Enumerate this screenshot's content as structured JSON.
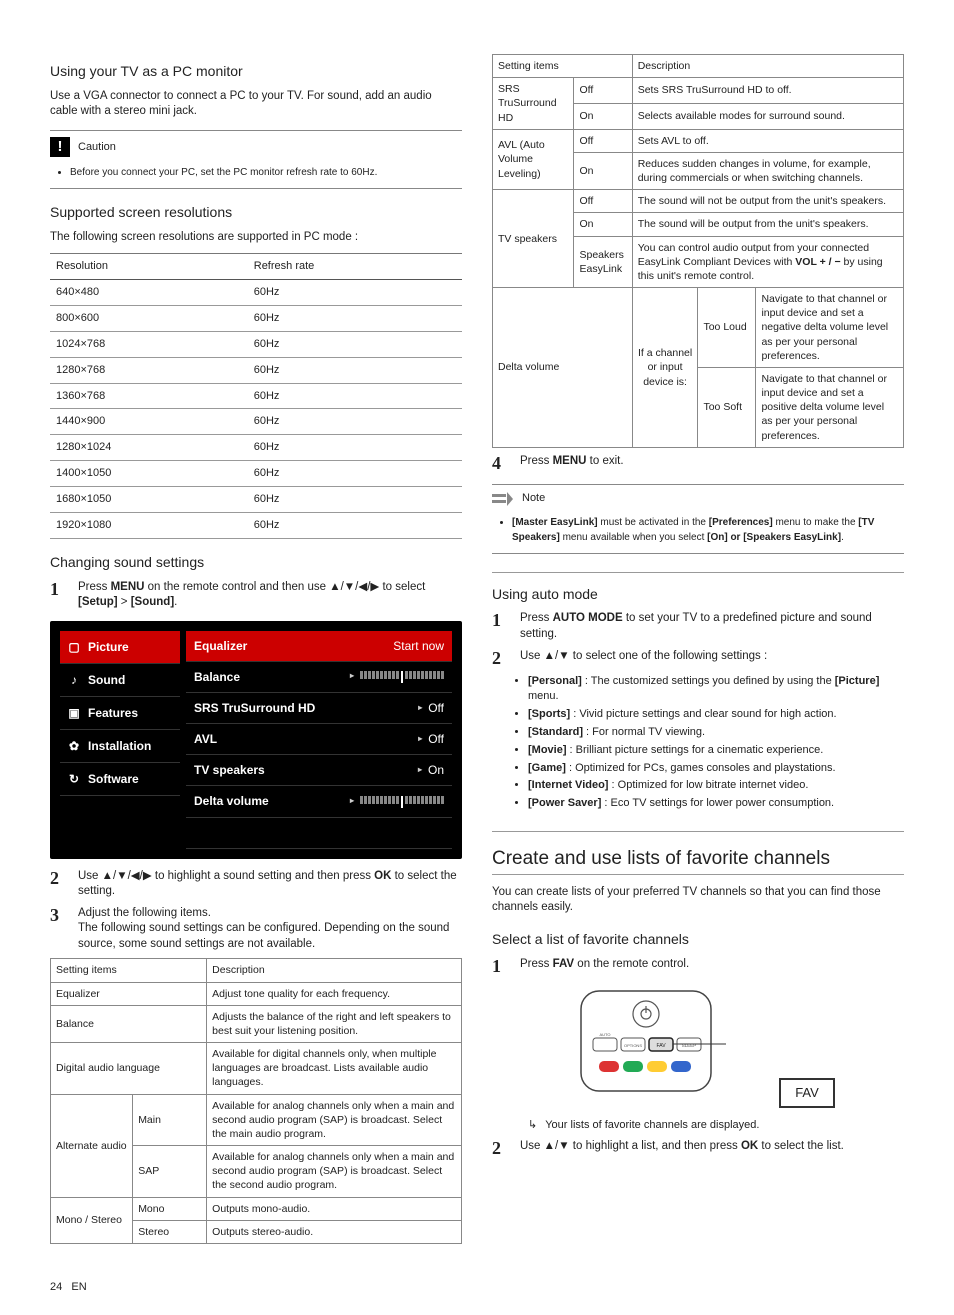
{
  "left": {
    "pc_monitor": {
      "heading": "Using your TV as a PC monitor",
      "body": "Use a VGA connector to connect a PC to your TV. For sound, add an audio cable with a stereo mini jack.",
      "caution_label": "Caution",
      "caution_text": "Before you connect your PC, set the PC monitor refresh rate to 60Hz."
    },
    "resolutions": {
      "heading": "Supported screen resolutions",
      "intro": "The following screen resolutions are supported in PC mode :",
      "col1": "Resolution",
      "col2": "Refresh rate",
      "rows": [
        [
          "640×480",
          "60Hz"
        ],
        [
          "800×600",
          "60Hz"
        ],
        [
          "1024×768",
          "60Hz"
        ],
        [
          "1280×768",
          "60Hz"
        ],
        [
          "1360×768",
          "60Hz"
        ],
        [
          "1440×900",
          "60Hz"
        ],
        [
          "1280×1024",
          "60Hz"
        ],
        [
          "1400×1050",
          "60Hz"
        ],
        [
          "1680×1050",
          "60Hz"
        ],
        [
          "1920×1080",
          "60Hz"
        ]
      ]
    },
    "sound": {
      "heading": "Changing sound settings",
      "step1_a": "Press ",
      "step1_b": "MENU",
      "step1_c": " on the remote control and then use ▲/▼/◀/▶ to select ",
      "step1_d": "[Setup]",
      "step1_e": " > ",
      "step1_f": "[Sound]",
      "step1_g": ".",
      "menu": {
        "left": [
          "Picture",
          "Sound",
          "Features",
          "Installation",
          "Software"
        ],
        "right": [
          {
            "l": "Equalizer",
            "v": "Start now",
            "active": true
          },
          {
            "l": "Balance",
            "v": "slider"
          },
          {
            "l": "SRS TruSurround HD",
            "v": "Off"
          },
          {
            "l": "AVL",
            "v": "Off"
          },
          {
            "l": "TV speakers",
            "v": "On"
          },
          {
            "l": "Delta volume",
            "v": "slider"
          }
        ]
      },
      "step2_a": "Use ▲/▼/◀/▶ to highlight a sound setting and then press ",
      "step2_b": "OK",
      "step2_c": " to select the setting.",
      "step3_a": "Adjust the following items.",
      "step3_b": "The following sound settings can be configured. Depending on the sound source, some sound settings are not available.",
      "table": {
        "h1": "Setting items",
        "h2": "Description",
        "rows": [
          {
            "i": "Equalizer",
            "d": "Adjust tone quality for each frequency."
          },
          {
            "i": "Balance",
            "d": "Adjusts the balance of the right and left speakers to best suit your listening position."
          },
          {
            "i": "Digital audio language",
            "d": "Available for digital channels only, when multiple languages are broadcast. Lists available audio languages."
          }
        ],
        "alt": {
          "name": "Alternate audio",
          "main": {
            "l": "Main",
            "d": "Available for analog channels only when a main and second audio program (SAP) is broadcast. Select the main audio program."
          },
          "sap": {
            "l": "SAP",
            "d": "Available for analog channels only when a main and second audio program (SAP) is broadcast. Select the second audio program."
          }
        },
        "ms": {
          "name": "Mono / Stereo",
          "mono": {
            "l": "Mono",
            "d": "Outputs mono-audio."
          },
          "stereo": {
            "l": "Stereo",
            "d": "Outputs stereo-audio."
          }
        }
      }
    }
  },
  "right": {
    "table2": {
      "h1": "Setting items",
      "h2": "Description",
      "srs": {
        "name": "SRS TruSurround HD",
        "off": {
          "l": "Off",
          "d": "Sets SRS TruSurround HD to off."
        },
        "on": {
          "l": "On",
          "d": "Selects available modes for surround sound."
        }
      },
      "avl": {
        "name": "AVL (Auto Volume Leveling)",
        "off": {
          "l": "Off",
          "d": "Sets AVL to off."
        },
        "on": {
          "l": "On",
          "d": "Reduces sudden changes in volume, for example, during commercials or when switching channels."
        }
      },
      "tvsp": {
        "name": "TV speakers",
        "off": {
          "l": "Off",
          "d": "The sound will not be output from the unit's speakers."
        },
        "on": {
          "l": "On",
          "d": "The sound will be output from the unit's speakers."
        },
        "ez": {
          "l": "Speakers EasyLink",
          "d": "You can control audio output from your connected EasyLink Compliant Devices with <b>VOL + / −</b> by using this unit's remote control."
        }
      },
      "delta": {
        "name": "Delta volume",
        "mid": "If a channel or input device is:",
        "loud": {
          "l": "Too Loud",
          "d": "Navigate to that channel or input device and set a negative delta volume level as per your personal preferences."
        },
        "soft": {
          "l": "Too Soft",
          "d": "Navigate to that channel or input device and set a positive delta volume level as per your personal preferences."
        }
      }
    },
    "step4_a": "Press ",
    "step4_b": "MENU",
    "step4_c": " to exit.",
    "note_label": "Note",
    "note_text": "<b>[Master EasyLink]</b> must be activated in the <b>[Preferences]</b> menu to make the <b>[TV Speakers]</b> menu available when you select <b>[On] or [Speakers EasyLink]</b>.",
    "auto": {
      "heading": "Using auto mode",
      "s1_a": "Press ",
      "s1_b": "AUTO MODE",
      "s1_c": " to set your TV to a predefined picture and sound setting.",
      "s2": "Use ▲/▼ to select one of the following settings :",
      "opts": [
        "<b>[Personal]</b> : The customized settings you defined by using the <b>[Picture]</b> menu.",
        "<b>[Sports]</b> : Vivid picture settings and clear sound for high action.",
        "<b>[Standard]</b> : For normal TV viewing.",
        "<b>[Movie]</b> : Brilliant picture settings for a cinematic experience.",
        "<b>[Game]</b> : Optimized for PCs, games consoles and playstations.",
        "<b>[Internet Video]</b> : Optimized for low bitrate internet video.",
        "<b>[Power Saver]</b> : Eco TV settings for lower power consumption."
      ]
    },
    "fav": {
      "heading": "Create and use lists of favorite channels",
      "intro": "You can create lists of your preferred TV channels so that you can find those channels easily.",
      "sub": "Select a list of favorite channels",
      "s1_a": "Press ",
      "s1_b": "FAV",
      "s1_c": " on the remote control.",
      "fav_box": "FAV",
      "r1": "Your lists of favorite channels are displayed.",
      "s2_a": "Use ▲/▼ to highlight a list, and then press ",
      "s2_b": "OK",
      "s2_c": " to select the list."
    }
  },
  "footer": {
    "page": "24",
    "lang": "EN"
  }
}
